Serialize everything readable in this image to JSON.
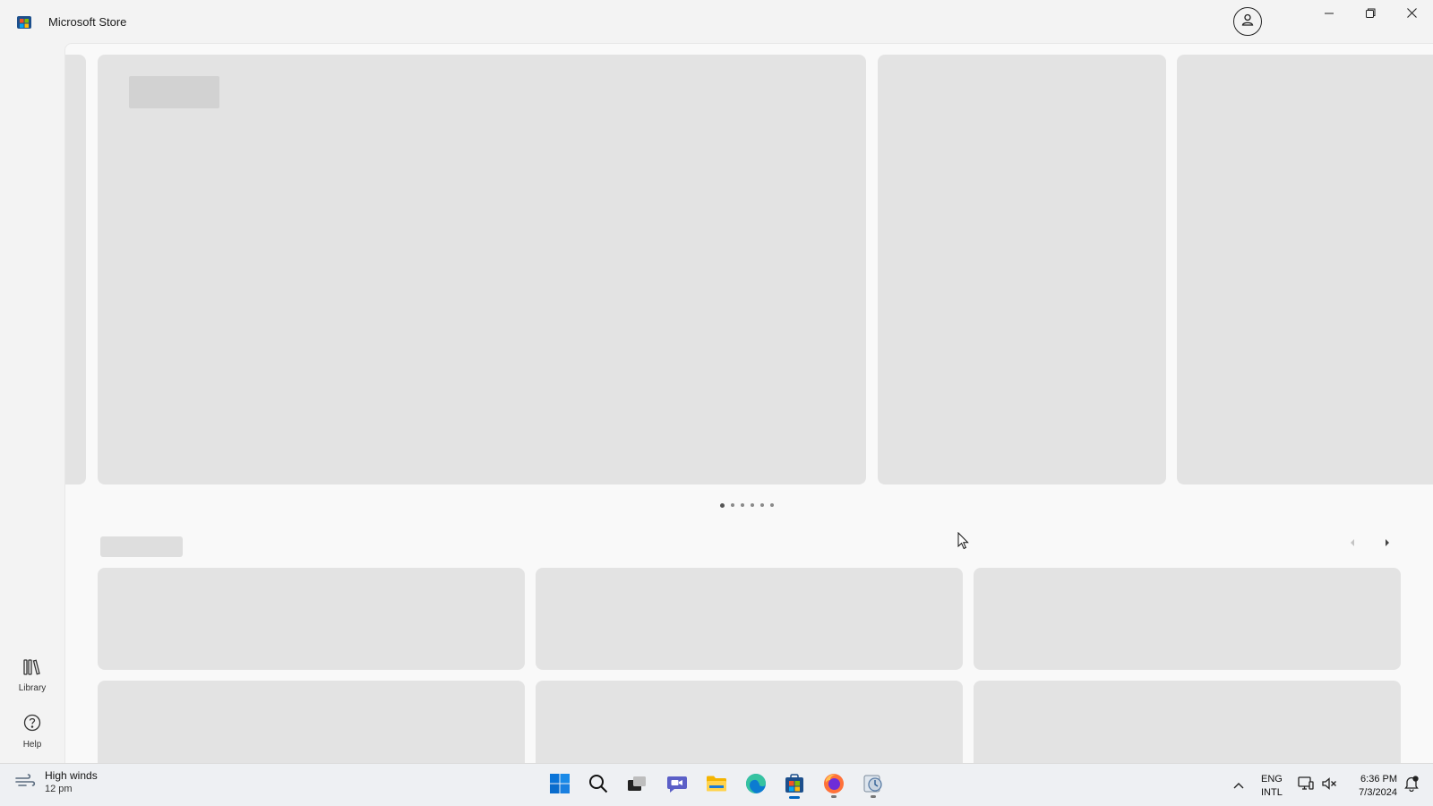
{
  "window": {
    "title": "Microsoft Store",
    "controls": {
      "minimize_icon": "minimize-icon",
      "maximize_icon": "restore-icon",
      "close_icon": "close-icon"
    }
  },
  "leftnav": {
    "items": [
      {
        "label": "Library",
        "icon": "library-icon"
      },
      {
        "label": "Help",
        "icon": "help-icon"
      }
    ]
  },
  "carousel": {
    "page_count": 6,
    "active_index": 0
  },
  "taskbar": {
    "weather": {
      "condition": "High winds",
      "time": "12 pm"
    },
    "apps": [
      "start",
      "search",
      "task-view",
      "teams-chat",
      "file-explorer",
      "edge",
      "microsoft-store",
      "firefox",
      "other-app"
    ],
    "language": {
      "line1": "ENG",
      "line2": "INTL"
    },
    "clock": {
      "time": "6:36 PM",
      "date": "7/3/2024"
    }
  },
  "colors": {
    "placeholder": "#e3e3e3",
    "placeholder_dark": "#d2d2d2",
    "accent": "#0067c0",
    "background": "#f3f3f3"
  }
}
